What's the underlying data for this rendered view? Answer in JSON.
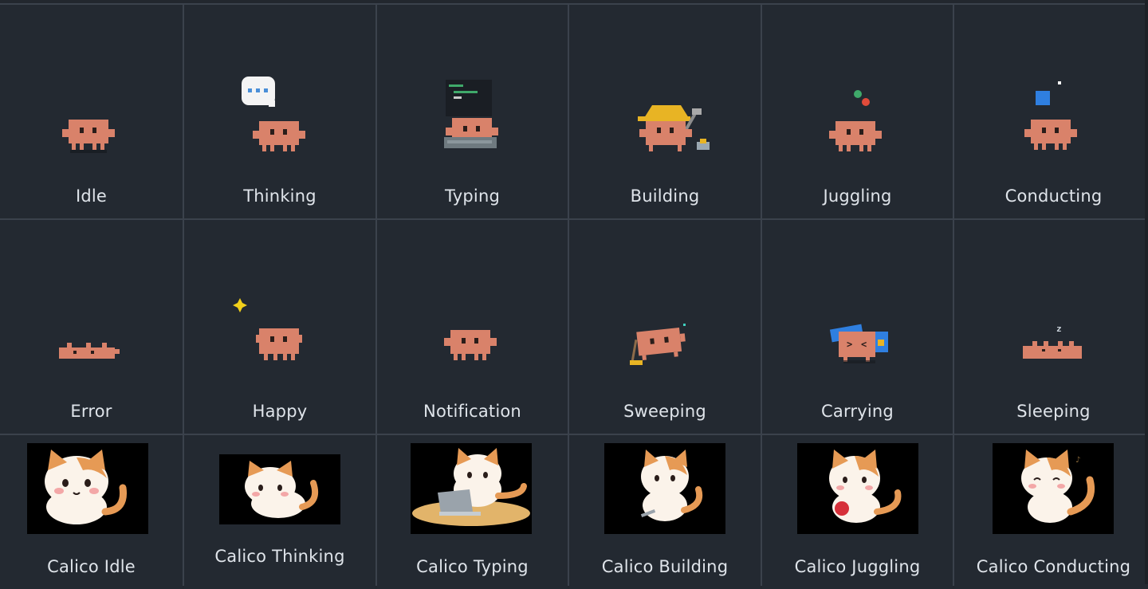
{
  "grid": {
    "row1": [
      {
        "label": "Idle",
        "icon": "crab-idle-icon"
      },
      {
        "label": "Thinking",
        "icon": "crab-thinking-icon"
      },
      {
        "label": "Typing",
        "icon": "crab-typing-icon"
      },
      {
        "label": "Building",
        "icon": "crab-building-icon"
      },
      {
        "label": "Juggling",
        "icon": "crab-juggling-icon"
      },
      {
        "label": "Conducting",
        "icon": "crab-conducting-icon"
      }
    ],
    "row2": [
      {
        "label": "Error",
        "icon": "crab-error-icon"
      },
      {
        "label": "Happy",
        "icon": "crab-happy-icon"
      },
      {
        "label": "Notification",
        "icon": "crab-notification-icon"
      },
      {
        "label": "Sweeping",
        "icon": "crab-sweeping-icon"
      },
      {
        "label": "Carrying",
        "icon": "crab-carrying-icon"
      },
      {
        "label": "Sleeping",
        "icon": "crab-sleeping-icon"
      }
    ],
    "row3": [
      {
        "label": "Calico Idle",
        "icon": "calico-idle-icon"
      },
      {
        "label": "Calico Thinking",
        "icon": "calico-thinking-icon"
      },
      {
        "label": "Calico Typing",
        "icon": "calico-typing-icon"
      },
      {
        "label": "Calico Building",
        "icon": "calico-building-icon"
      },
      {
        "label": "Calico Juggling",
        "icon": "calico-juggling-icon"
      },
      {
        "label": "Calico Conducting",
        "icon": "calico-conducting-icon"
      }
    ]
  },
  "colors": {
    "background": "#232931",
    "grid_line": "#3b424c",
    "label": "#dfe4ea",
    "crab": "#d9826a",
    "crab_shadow": "#b4624e"
  }
}
